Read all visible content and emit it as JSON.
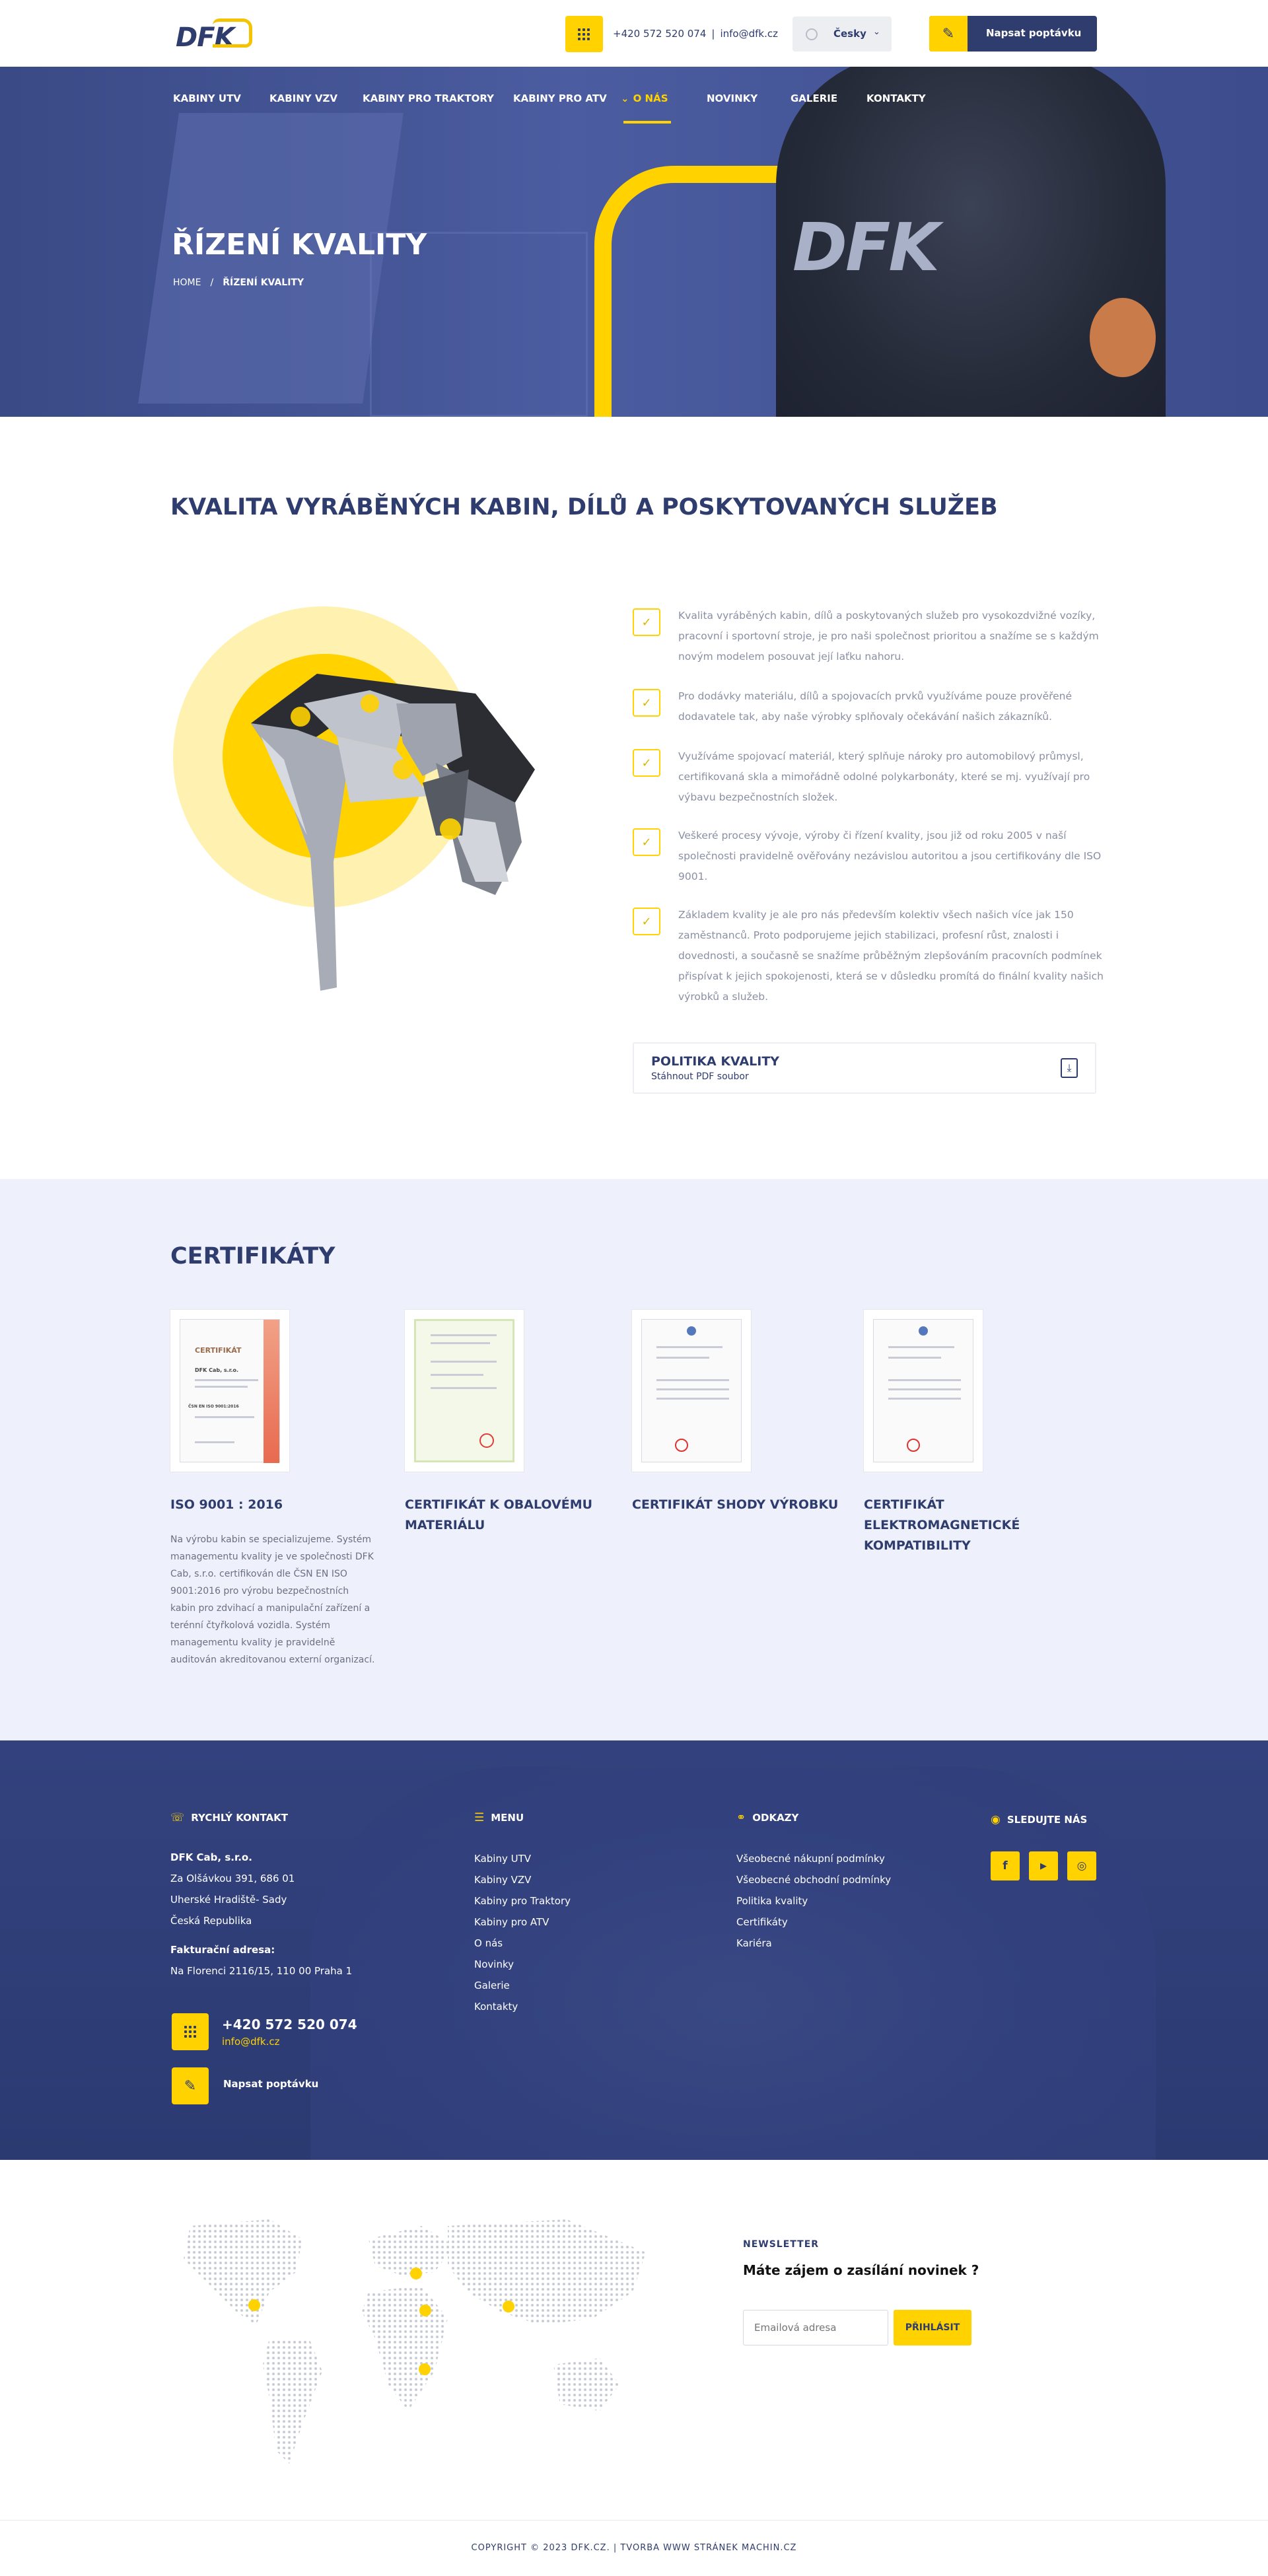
{
  "header": {
    "logo_text": "DFK",
    "phone": "+420 572 520 074",
    "separator": "|",
    "email": "info@dfk.cz",
    "language": "Česky",
    "cta_label": "Napsat poptávku"
  },
  "nav": {
    "items": [
      {
        "label": "Kabiny UTV"
      },
      {
        "label": "Kabiny VZV"
      },
      {
        "label": "Kabiny pro traktory"
      },
      {
        "label": "Kabiny pro ATV"
      },
      {
        "label": "O nás",
        "active": true
      },
      {
        "label": "Novinky"
      },
      {
        "label": "Galerie"
      },
      {
        "label": "Kontakty"
      }
    ]
  },
  "hero": {
    "title": "ŘÍZENÍ KVALITY",
    "vest_logo": "DFK",
    "breadcrumb": {
      "home": "HOME",
      "separator": "/",
      "current": "ŘÍZENÍ KVALITY"
    }
  },
  "quality": {
    "title": "KVALITA VYRÁBĚNÝCH KABIN, DÍLŮ A POSKYTOVANÝCH SLUŽEB",
    "points": [
      "Kvalita vyráběných kabin, dílů a poskytovaných služeb pro vysokozdvižné vozíky, pracovní i sportovní stroje, je pro naši společnost prioritou a snažíme se s každým novým modelem posouvat její laťku nahoru.",
      "Pro dodávky materiálu, dílů a spojovacích prvků využíváme pouze prověřené dodavatele tak, aby naše výrobky splňovaly očekávání našich zákazníků.",
      "Využíváme spojovací materiál, který splňuje nároky pro automobilový průmysl, certifikovaná skla a mimořádně odolné polykarbonáty, které se mj. využívají pro výbavu bezpečnostních složek.",
      "Veškeré procesy vývoje, výroby či řízení kvality, jsou již od roku 2005 v naší společnosti pravidelně ověřovány nezávislou autoritou a jsou certifikovány dle ISO 9001.",
      "Základem kvality je ale pro nás především kolektiv všech našich více jak 150 zaměstnanců. Proto podporujeme jejich stabilizaci, profesní růst, znalosti i dovednosti, a současně se snažíme průběžným zlepšováním pracovních podmínek přispívat k jejich spokojenosti, která se v důsledku promítá do finální kvality našich výrobků a služeb."
    ],
    "pdf": {
      "title": "POLITIKA KVALITY",
      "subtitle": "Stáhnout PDF soubor"
    }
  },
  "certificates": {
    "title": "CERTIFIKÁTY",
    "items": [
      {
        "title": "ISO 9001 : 2016",
        "doc_heading": "CERTIFIKÁT",
        "doc_company": "DFK Cab, s.r.o.",
        "doc_standard": "ČSN EN ISO 9001:2016",
        "description": "Na výrobu kabin se specializujeme. Systém managementu kvality je ve společnosti DFK Cab, s.r.o. certifikován dle ČSN EN ISO 9001:2016 pro výrobu bezpečnostních kabin pro zdvihací a manipulační zařízení a terénní čtyřkolová vozidla. Systém managementu kvality je pravidelně auditován akreditovanou externí organizací."
      },
      {
        "title": "CERTIFIKÁT K OBALOVÉMU MATERIÁLU"
      },
      {
        "title": "CERTIFIKÁT SHODY VÝROBKU"
      },
      {
        "title": "CERTIFIKÁT ELEKTROMAGNETICKÉ KOMPATIBILITY"
      }
    ]
  },
  "footer": {
    "contact": {
      "heading": "RYCHLÝ KONTAKT",
      "company": "DFK Cab, s.r.o.",
      "address": [
        "Za Olšávkou 391, 686 01",
        "Uherské Hradiště- Sady",
        "Česká Republika"
      ],
      "billing_label": "Fakturační adresa:",
      "billing_address": "Na Florenci 2116/15, 110 00 Praha 1",
      "phone": "+420 572 520 074",
      "email": "info@dfk.cz",
      "cta": "Napsat poptávku"
    },
    "menu": {
      "heading": "MENU",
      "items": [
        "Kabiny UTV",
        "Kabiny VZV",
        "Kabiny pro Traktory",
        "Kabiny pro ATV",
        "O nás",
        "Novinky",
        "Galerie",
        "Kontakty"
      ]
    },
    "links": {
      "heading": "ODKAZY",
      "items": [
        "Všeobecné nákupní podmínky",
        "Všeobecné obchodní podmínky",
        "Politika kvality",
        "Certifikáty",
        "Kariéra"
      ]
    },
    "social": {
      "heading": "SLEDUJTE NÁS",
      "icons": [
        {
          "name": "facebook-icon",
          "glyph": "f"
        },
        {
          "name": "youtube-icon",
          "glyph": "▶"
        },
        {
          "name": "instagram-icon",
          "glyph": "◎"
        }
      ]
    }
  },
  "newsletter": {
    "label": "NEWSLETTER",
    "question": "Máte zájem o zasílání novinek ?",
    "placeholder": "Emailová adresa",
    "button": "PŘIHLÁSIT"
  },
  "copyright": "COPYRIGHT © 2023 DFK.CZ.  |  TVORBA WWW STRÁNEK MACHIN.CZ",
  "colors": {
    "brand_navy": "#2f3c6e",
    "brand_yellow": "#ffd200",
    "light_bg": "#eef1fb"
  }
}
